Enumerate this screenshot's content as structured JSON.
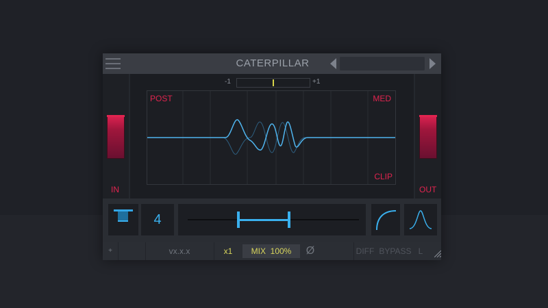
{
  "plugin": {
    "title": "CATERPILLAR",
    "balance": {
      "min_label": "-1",
      "max_label": "+1",
      "value": 0.0
    },
    "input_meter": {
      "label": "IN",
      "level": 0.3
    },
    "output_meter": {
      "label": "OUT",
      "level": 0.3
    },
    "scope": {
      "top_left_label": "POST",
      "top_right_label": "MED",
      "bottom_right_label": "CLIP"
    },
    "controls": {
      "count_value": "4",
      "range_low": 0.3,
      "range_high": 0.6
    },
    "status": {
      "version": "vx.x.x",
      "rate": "x1",
      "mix_label": "MIX",
      "mix_value": "100%",
      "phase_symbol": "Ø",
      "diff_label": "DIFF",
      "bypass_label": "BYPASS",
      "lr_label": "L"
    },
    "colors": {
      "accent_blue": "#3ab0ee",
      "accent_red": "#e0244f",
      "accent_yellow": "#d7d45c"
    },
    "icons": [
      "menu-icon",
      "shape-icon",
      "curve-icon",
      "bell-curve-icon",
      "resize-icon"
    ]
  }
}
